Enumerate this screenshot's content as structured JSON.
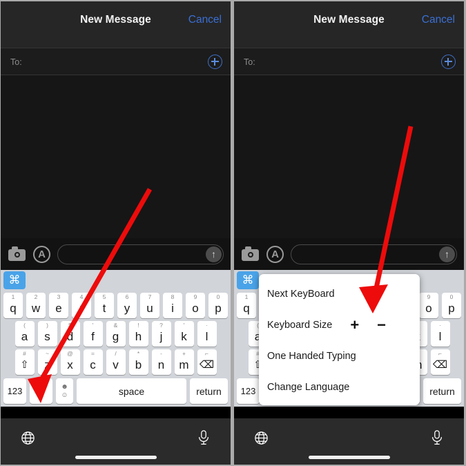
{
  "nav": {
    "title": "New Message",
    "cancel_label": "Cancel",
    "cancel_color": "#3b6fd4"
  },
  "recipients": {
    "to_label": "To:",
    "add_contact_icon": "plus-circle-icon"
  },
  "input_toolbar": {
    "camera_icon": "camera-icon",
    "appstore_icon": "app-store-icon",
    "appstore_glyph": "A",
    "send_icon": "arrow-up-icon",
    "send_glyph": "↑",
    "message_placeholder": ""
  },
  "keyboard": {
    "command_key_glyph": "⌘",
    "command_key_color": "#4aa3e8",
    "row1": [
      {
        "glyph": "q",
        "hint": "1"
      },
      {
        "glyph": "w",
        "hint": "2"
      },
      {
        "glyph": "e",
        "hint": "3"
      },
      {
        "glyph": "r",
        "hint": "4"
      },
      {
        "glyph": "t",
        "hint": "5"
      },
      {
        "glyph": "y",
        "hint": "6"
      },
      {
        "glyph": "u",
        "hint": "7"
      },
      {
        "glyph": "i",
        "hint": "8"
      },
      {
        "glyph": "o",
        "hint": "9"
      },
      {
        "glyph": "p",
        "hint": "0"
      }
    ],
    "row2": [
      {
        "glyph": "a",
        "hint": "("
      },
      {
        "glyph": "s",
        "hint": ")"
      },
      {
        "glyph": "d",
        "hint": "$"
      },
      {
        "glyph": "f",
        "hint": "'"
      },
      {
        "glyph": "g",
        "hint": "&"
      },
      {
        "glyph": "h",
        "hint": "!"
      },
      {
        "glyph": "j",
        "hint": "?"
      },
      {
        "glyph": "k",
        "hint": "'"
      },
      {
        "glyph": "l",
        "hint": "·"
      }
    ],
    "row3": [
      {
        "glyph": "⇧",
        "hint": "#",
        "name": "shift-key"
      },
      {
        "glyph": "z",
        "hint": "~",
        "name": "key-z"
      },
      {
        "glyph": "x",
        "hint": "@",
        "name": "key-x"
      },
      {
        "glyph": "c",
        "hint": "=",
        "name": "key-c"
      },
      {
        "glyph": "v",
        "hint": "/",
        "name": "key-v"
      },
      {
        "glyph": "b",
        "hint": "*",
        "name": "key-b"
      },
      {
        "glyph": "n",
        "hint": "-",
        "name": "key-n"
      },
      {
        "glyph": "m",
        "hint": "+",
        "name": "key-m"
      },
      {
        "glyph": "⌫",
        "hint": "⌐",
        "name": "backspace-key"
      }
    ],
    "row4": {
      "numeric_label": "123",
      "gear_icon": "gear-icon",
      "gear_glyph": "✿",
      "gear_active_color": "#1414d8",
      "emoji_icon": "emoji-icon",
      "emoji_glyph_top": "☻",
      "emoji_glyph_bottom": "☺",
      "space_label": "space",
      "return_label": "return"
    }
  },
  "bottom_bar": {
    "globe_icon": "globe-icon",
    "globe_glyph": "✹",
    "mic_icon": "microphone-icon",
    "home_indicator": "home-indicator"
  },
  "popup_menu": {
    "items": [
      {
        "label": "Next KeyBoard",
        "name": "menu-item-next-keyboard"
      },
      {
        "label": "Keyboard Size",
        "name": "menu-item-keyboard-size"
      },
      {
        "label": "One Handed Typing",
        "name": "menu-item-one-handed-typing"
      },
      {
        "label": "Change Language",
        "name": "menu-item-change-language"
      }
    ],
    "size_increase_label": "+",
    "size_decrease_label": "−"
  },
  "annotations": {
    "arrow_color": "#ed0b0b",
    "left_arrow_target": "gear-key",
    "right_arrow_target": "keyboard-size-decrease-button"
  }
}
